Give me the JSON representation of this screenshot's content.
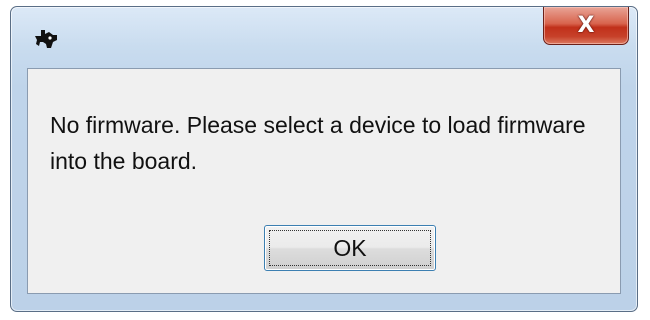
{
  "dialog": {
    "title": "",
    "close_label": "X",
    "message": "No firmware. Please select a device to load firmware into the board.",
    "ok_label": "OK"
  },
  "icons": {
    "app_icon": "texas-instruments-logo-icon"
  },
  "colors": {
    "frame": "#c9dcef",
    "close_button": "#c7412a",
    "client_background": "#f0f0f0",
    "ok_button_border": "#3c7fb1"
  }
}
